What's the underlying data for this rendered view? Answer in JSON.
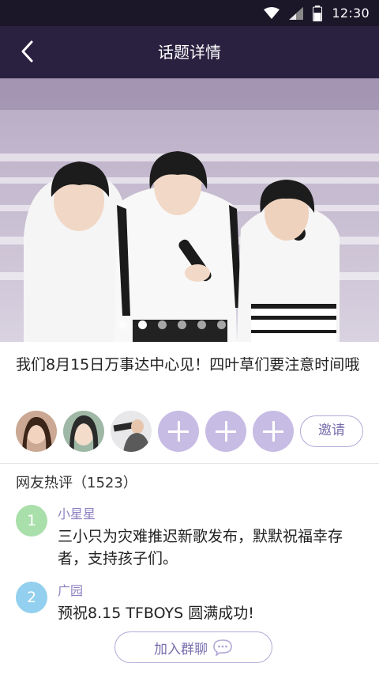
{
  "status_bar": {
    "time": "12:30",
    "icons": [
      "wifi-icon",
      "signal-icon",
      "battery-icon"
    ]
  },
  "header": {
    "title": "话题详情",
    "back_icon": "chevron-left-icon"
  },
  "hero": {
    "description_icon": "photo",
    "carousel_pages": 6,
    "carousel_active": 1
  },
  "topic": {
    "text": "我们8月15日万事达中心见！四叶草们要注意时间哦"
  },
  "participants": {
    "avatars": [
      "avatar-1",
      "avatar-2",
      "avatar-3"
    ],
    "empty_slots": 3,
    "invite_label": "邀请"
  },
  "comments": {
    "title": "网友热评（1523）",
    "items": [
      {
        "rank": "1",
        "user": "小星星",
        "text": "三小只为灾难推迟新歌发布，默默祝福幸存者，支持孩子们。"
      },
      {
        "rank": "2",
        "user": "广园",
        "text": "预祝8.15 TFBOYS 圆满成功!"
      }
    ]
  },
  "join_chat": {
    "label": "加入群聊",
    "icon": "chat-bubble-icon"
  },
  "colors": {
    "header_bg": "#2a2140",
    "status_bg": "#1b1628",
    "accent": "#b3a8d6",
    "plus_bg": "#c7bce4",
    "rank1": "#a9dfaa",
    "rank2": "#93cfee"
  }
}
